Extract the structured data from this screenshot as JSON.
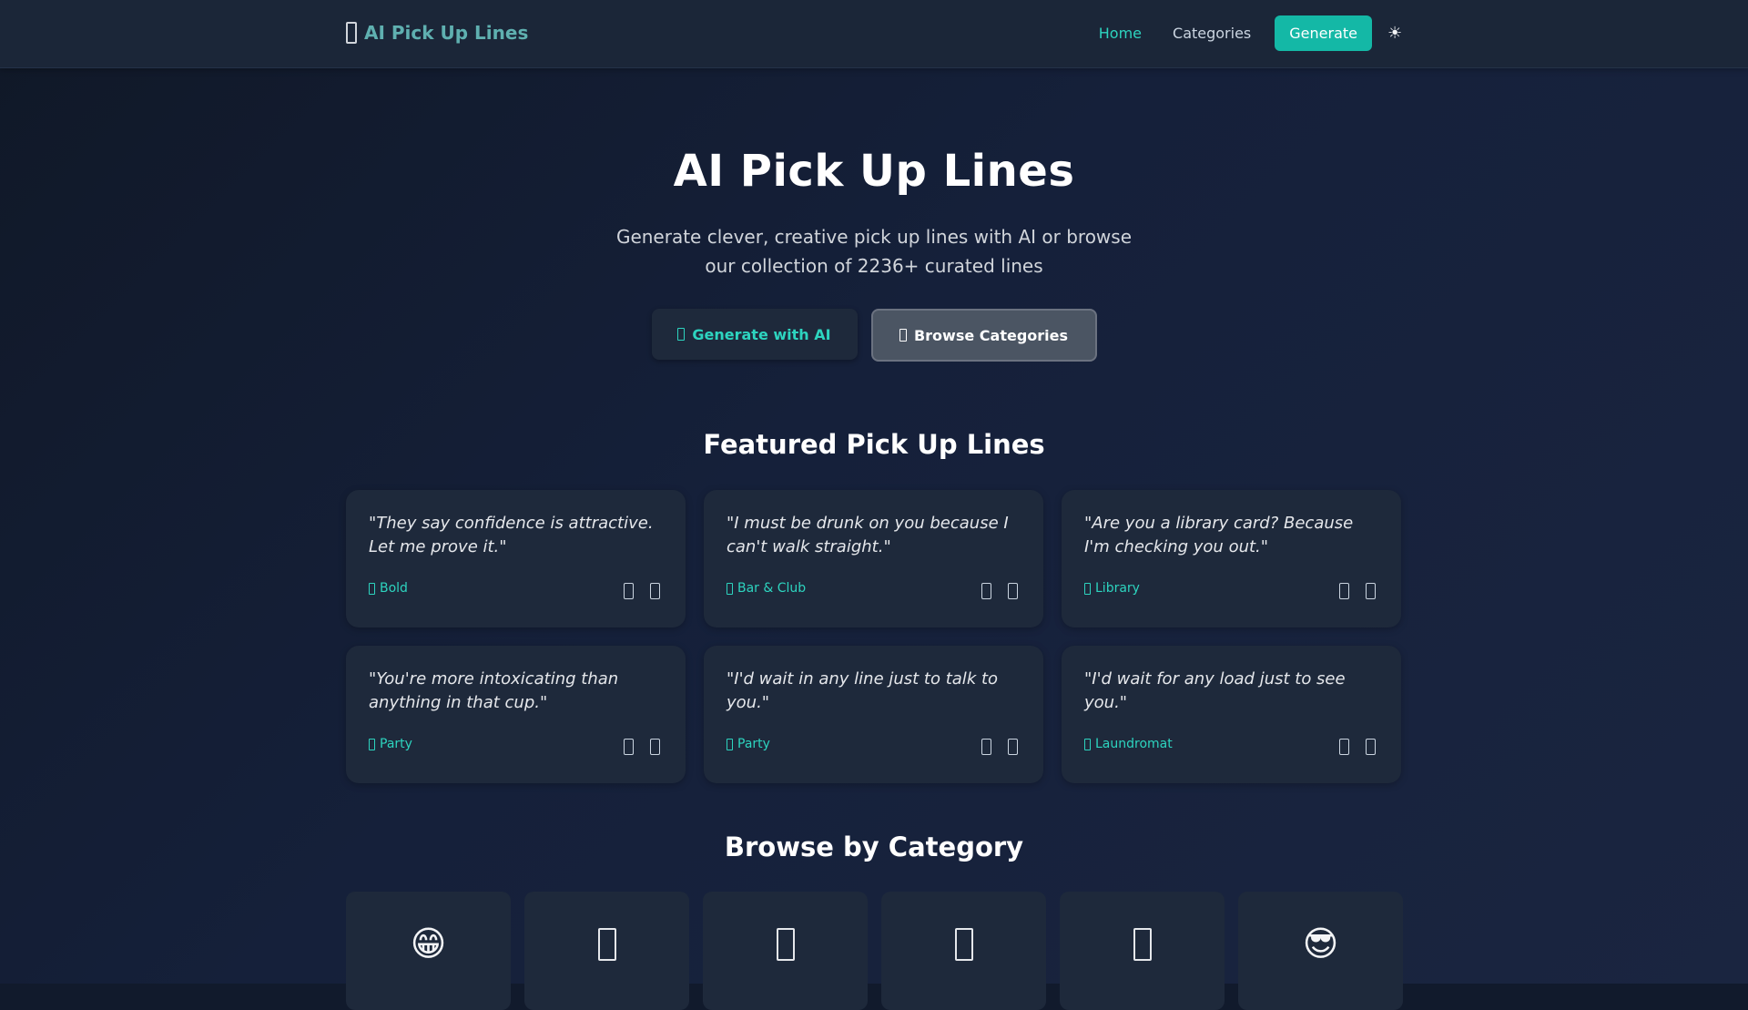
{
  "header": {
    "brand_text": "AI Pick Up Lines",
    "nav": {
      "home": "Home",
      "categories": "Categories",
      "generate": "Generate",
      "theme_toggle": "☀"
    }
  },
  "hero": {
    "title": "AI Pick Up Lines",
    "subtitle": "Generate clever, creative pick up lines with AI or browse our collection of 2236+ curated lines",
    "generate_button": "Generate with AI",
    "browse_button": "Browse Categories"
  },
  "featured": {
    "title": "Featured Pick Up Lines",
    "cards": [
      {
        "quote": "\"They say confidence is attractive. Let me prove it.\"",
        "category": "Bold"
      },
      {
        "quote": "\"I must be drunk on you because I can't walk straight.\"",
        "category": "Bar & Club"
      },
      {
        "quote": "\"Are you a library card? Because I'm checking you out.\"",
        "category": "Library"
      },
      {
        "quote": "\"You're more intoxicating than anything in that cup.\"",
        "category": "Party"
      },
      {
        "quote": "\"I'd wait in any line just to talk to you.\"",
        "category": "Party"
      },
      {
        "quote": "\"I'd wait for any load just to see you.\"",
        "category": "Laundromat"
      }
    ]
  },
  "browse": {
    "title": "Browse by Category",
    "categories": [
      {
        "icon": "grinning-face-emoji",
        "glyph": "😁"
      },
      {
        "icon": "missing-glyph-icon",
        "glyph": ""
      },
      {
        "icon": "missing-glyph-icon",
        "glyph": ""
      },
      {
        "icon": "missing-glyph-icon",
        "glyph": ""
      },
      {
        "icon": "missing-glyph-icon",
        "glyph": ""
      },
      {
        "icon": "sunglasses-face-emoji",
        "glyph": "😎"
      }
    ]
  },
  "colors": {
    "accent": "#14b8a6",
    "accent_text": "#2dd4bf",
    "card_bg": "#1e293b",
    "page_bg": "#111a2c"
  }
}
